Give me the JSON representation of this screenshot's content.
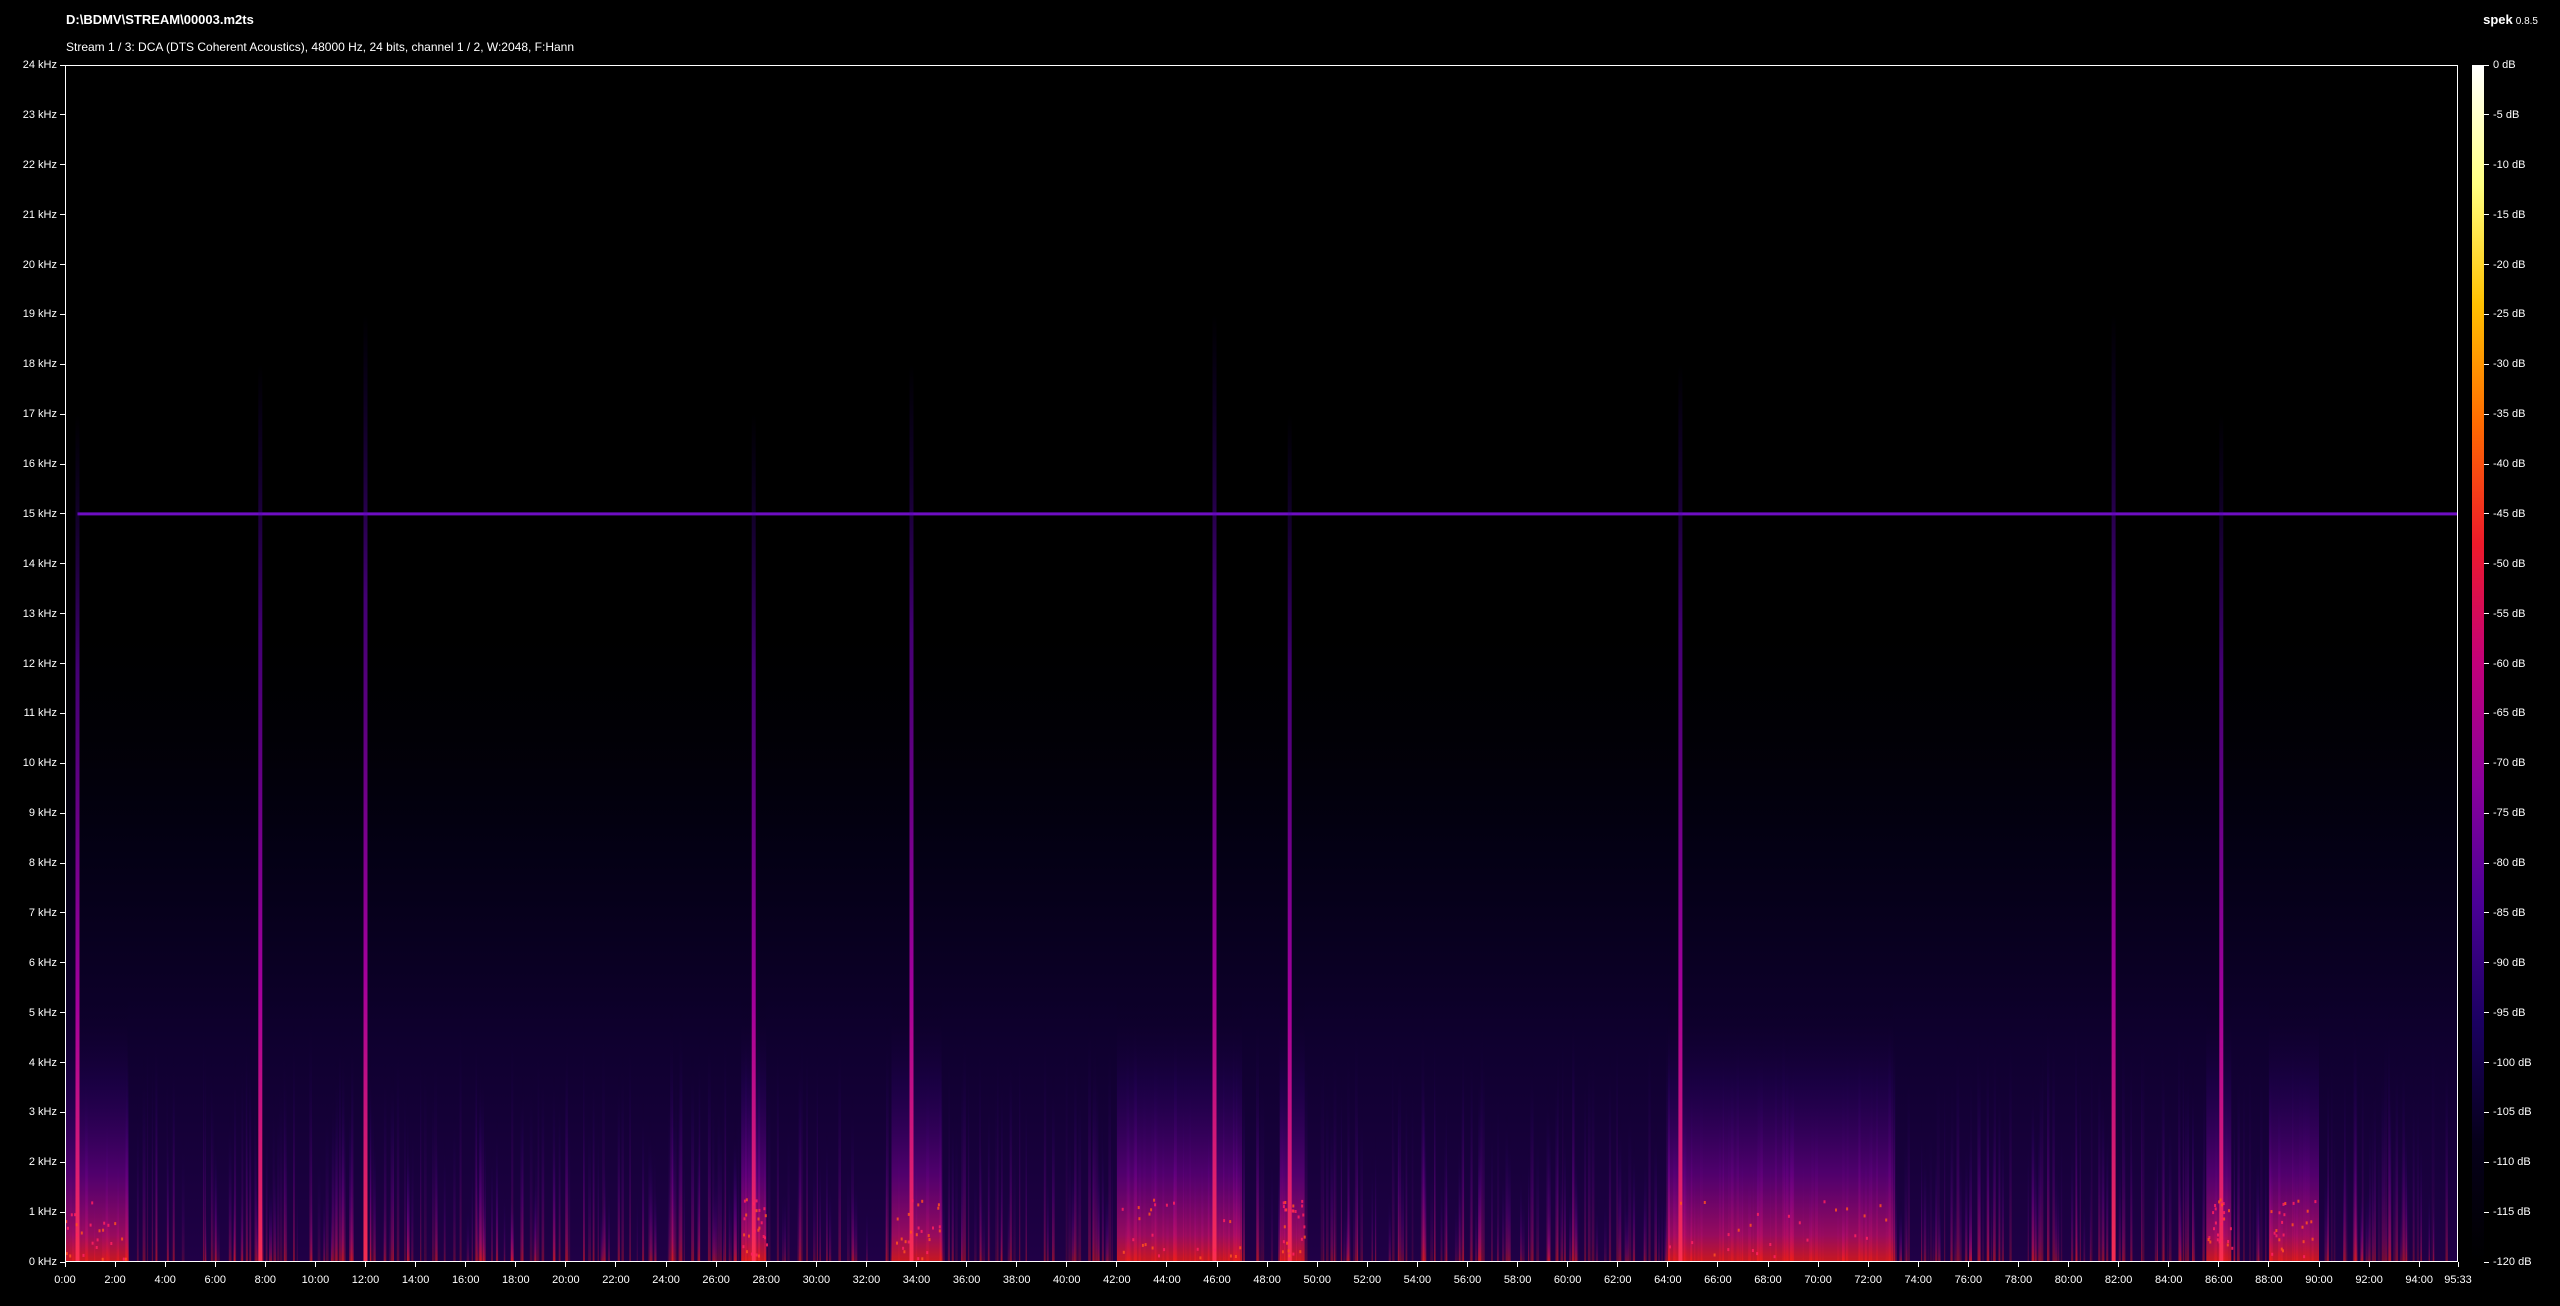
{
  "header": {
    "file_path": "D:\\BDMV\\STREAM\\00003.m2ts",
    "stream_info": "Stream 1 / 3: DCA (DTS Coherent Acoustics), 48000 Hz, 24 bits, channel 1 / 2, W:2048, F:Hann",
    "app_name": "spek",
    "app_version": "0.8.5"
  },
  "colors": {
    "background": "#000000",
    "text": "#ffffff",
    "palette": [
      "#000000",
      "#06001a",
      "#1a0060",
      "#4a0096",
      "#8a009c",
      "#c2007a",
      "#ee1a2a",
      "#ff6a00",
      "#ffc000",
      "#ffff80",
      "#ffffff"
    ]
  },
  "chart_data": {
    "type": "heatmap",
    "title": "",
    "xlabel": "",
    "ylabel": "",
    "x_axis": {
      "range_seconds": [
        0,
        5733
      ],
      "tick_labels": [
        "0:00",
        "2:00",
        "4:00",
        "6:00",
        "8:00",
        "10:00",
        "12:00",
        "14:00",
        "16:00",
        "18:00",
        "20:00",
        "22:00",
        "24:00",
        "26:00",
        "28:00",
        "30:00",
        "32:00",
        "34:00",
        "36:00",
        "38:00",
        "40:00",
        "42:00",
        "44:00",
        "46:00",
        "48:00",
        "50:00",
        "52:00",
        "54:00",
        "56:00",
        "58:00",
        "60:00",
        "62:00",
        "64:00",
        "66:00",
        "68:00",
        "70:00",
        "72:00",
        "74:00",
        "76:00",
        "78:00",
        "80:00",
        "82:00",
        "84:00",
        "86:00",
        "88:00",
        "90:00",
        "92:00",
        "94:00",
        "95:33"
      ]
    },
    "y_axis": {
      "unit": "kHz",
      "range": [
        0,
        24
      ],
      "tick_labels": [
        "0 kHz",
        "1 kHz",
        "2 kHz",
        "3 kHz",
        "4 kHz",
        "5 kHz",
        "6 kHz",
        "7 kHz",
        "8 kHz",
        "9 kHz",
        "10 kHz",
        "11 kHz",
        "12 kHz",
        "13 kHz",
        "14 kHz",
        "15 kHz",
        "16 kHz",
        "17 kHz",
        "18 kHz",
        "19 kHz",
        "20 kHz",
        "21 kHz",
        "22 kHz",
        "23 kHz",
        "24 kHz"
      ]
    },
    "color_scale": {
      "unit": "dB",
      "range": [
        -120,
        0
      ],
      "tick_labels": [
        "0 dB",
        "-5 dB",
        "-10 dB",
        "-15 dB",
        "-20 dB",
        "-25 dB",
        "-30 dB",
        "-35 dB",
        "-40 dB",
        "-45 dB",
        "-50 dB",
        "-55 dB",
        "-60 dB",
        "-65 dB",
        "-70 dB",
        "-75 dB",
        "-80 dB",
        "-85 dB",
        "-90 dB",
        "-95 dB",
        "-100 dB",
        "-105 dB",
        "-110 dB",
        "-115 dB",
        "-120 dB"
      ]
    },
    "features": {
      "constant_tone_khz": 15,
      "spikes_minutes": [
        0.5,
        7.8,
        12,
        27.5,
        33.8,
        45.9,
        48.9,
        64.5,
        81.8,
        86.1
      ],
      "loud_regions_minutes": [
        [
          0,
          2.5
        ],
        [
          27,
          28
        ],
        [
          33,
          35
        ],
        [
          42,
          47
        ],
        [
          48.5,
          49.5
        ],
        [
          64,
          73
        ],
        [
          85.5,
          86.5
        ],
        [
          88,
          90
        ]
      ]
    }
  }
}
